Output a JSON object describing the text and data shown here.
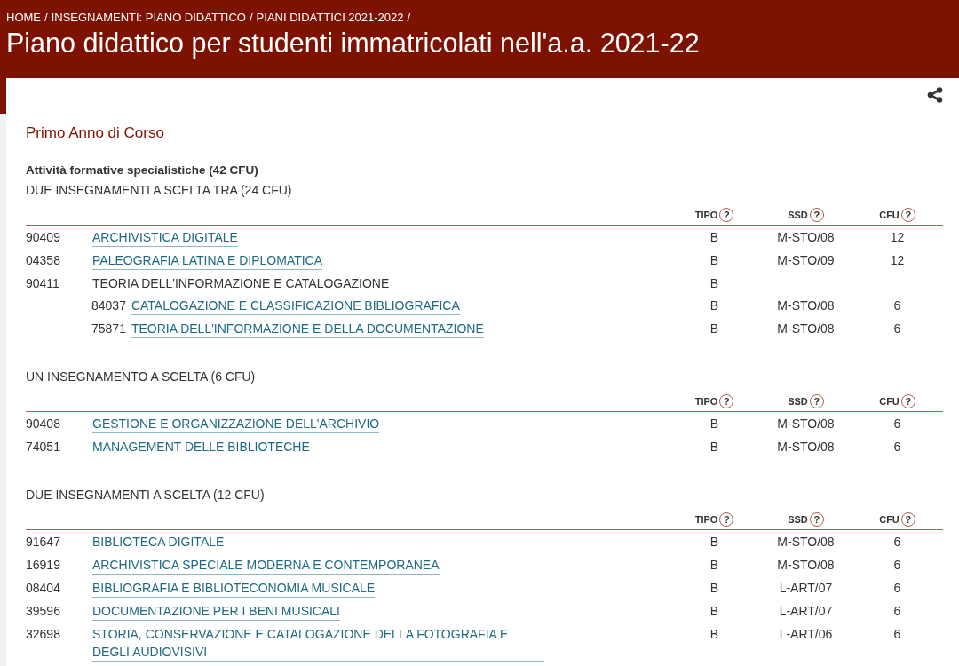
{
  "breadcrumb": {
    "items": [
      "HOME",
      "INSEGNAMENTI: PIANO DIDATTICO",
      "PIANI DIDATTICI 2021-2022"
    ],
    "separator": "/"
  },
  "title": "Piano didattico per studenti immatricolati nell'a.a. 2021-22",
  "year_heading": "Primo Anno di Corso",
  "group_heading": "Attività formative specialistiche (42 CFU)",
  "sections": [
    {
      "title": "DUE INSEGNAMENTI A SCELTA TRA (24 CFU)",
      "columns": [
        {
          "label": "TIPO",
          "help": "?"
        },
        {
          "label": "SSD",
          "help": "?"
        },
        {
          "label": "CFU",
          "help": "?"
        }
      ],
      "rows": [
        {
          "code": "90409",
          "title": "ARCHIVISTICA DIGITALE",
          "link": true,
          "tipo": "B",
          "ssd": "M-STO/08",
          "cfu": "12"
        },
        {
          "code": "04358",
          "title": "PALEOGRAFIA LATINA E DIPLOMATICA",
          "link": true,
          "tipo": "B",
          "ssd": "M-STO/09",
          "cfu": "12"
        },
        {
          "code": "90411",
          "title": "TEORIA DELL'INFORMAZIONE E CATALOGAZIONE",
          "link": false,
          "tipo": "B",
          "children": [
            {
              "code": "84037",
              "title": "CATALOGAZIONE E CLASSIFICAZIONE BIBLIOGRAFICA",
              "link": true,
              "tipo": "B",
              "ssd": "M-STO/08",
              "cfu": "6"
            },
            {
              "code": "75871",
              "title": "TEORIA DELL'INFORMAZIONE E DELLA DOCUMENTAZIONE",
              "link": true,
              "tipo": "B",
              "ssd": "M-STO/08",
              "cfu": "6"
            }
          ]
        }
      ]
    },
    {
      "title": "UN INSEGNAMENTO A SCELTA (6 CFU)",
      "columns": [
        {
          "label": "TIPO",
          "help": "?"
        },
        {
          "label": "SSD",
          "help": "?"
        },
        {
          "label": "CFU",
          "help": "?"
        }
      ],
      "rows": [
        {
          "code": "90408",
          "title": "GESTIONE E ORGANIZZAZIONE DELL'ARCHIVIO",
          "link": true,
          "tipo": "B",
          "ssd": "M-STO/08",
          "cfu": "6"
        },
        {
          "code": "74051",
          "title": "MANAGEMENT DELLE BIBLIOTECHE",
          "link": true,
          "tipo": "B",
          "ssd": "M-STO/08",
          "cfu": "6"
        }
      ]
    },
    {
      "title": "DUE INSEGNAMENTI A SCELTA (12 CFU)",
      "columns": [
        {
          "label": "TIPO",
          "help": "?"
        },
        {
          "label": "SSD",
          "help": "?"
        },
        {
          "label": "CFU",
          "help": "?"
        }
      ],
      "rows": [
        {
          "code": "91647",
          "title": "BIBLIOTECA DIGITALE",
          "link": true,
          "tipo": "B",
          "ssd": "M-STO/08",
          "cfu": "6"
        },
        {
          "code": "16919",
          "title": "ARCHIVISTICA SPECIALE MODERNA E CONTEMPORANEA",
          "link": true,
          "tipo": "B",
          "ssd": "M-STO/08",
          "cfu": "6"
        },
        {
          "code": "08404",
          "title": "BIBLIOGRAFIA E BIBLIOTECONOMIA MUSICALE",
          "link": true,
          "tipo": "B",
          "ssd": "L-ART/07",
          "cfu": "6"
        },
        {
          "code": "39596",
          "title": "DOCUMENTAZIONE PER I BENI MUSICALI",
          "link": true,
          "tipo": "B",
          "ssd": "L-ART/07",
          "cfu": "6"
        },
        {
          "code": "32698",
          "title": "STORIA, CONSERVAZIONE E CATALOGAZIONE DELLA FOTOGRAFIA E DEGLI AUDIOVISIVI",
          "link": true,
          "tipo": "B",
          "ssd": "L-ART/06",
          "cfu": "6"
        }
      ]
    }
  ]
}
